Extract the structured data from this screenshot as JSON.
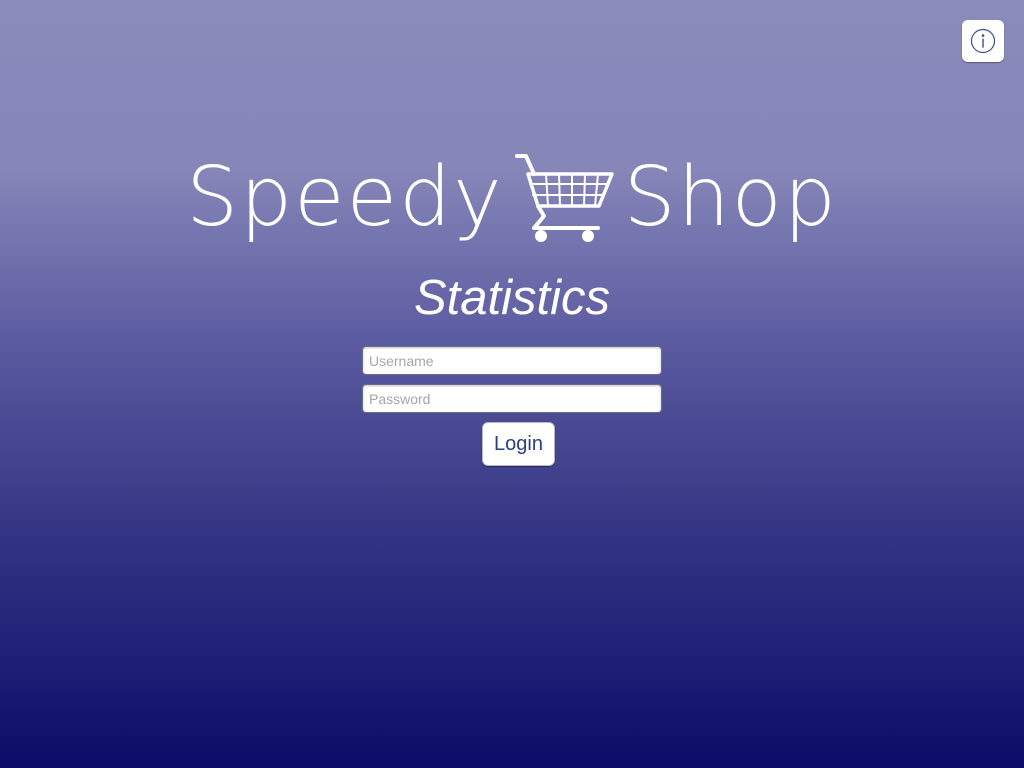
{
  "app": {
    "brand_left": "Speedy",
    "brand_right": "Shop",
    "subtitle": "Statistics"
  },
  "icons": {
    "info": "info-icon",
    "cart": "shopping-cart-icon"
  },
  "login_form": {
    "username_placeholder": "Username",
    "username_value": "",
    "password_placeholder": "Password",
    "password_value": "",
    "login_label": "Login"
  },
  "colors": {
    "background_top": "#8a8abb",
    "background_bottom": "#0c0c68",
    "button_text": "#2b3f7a",
    "logo_text": "#ffffff"
  }
}
